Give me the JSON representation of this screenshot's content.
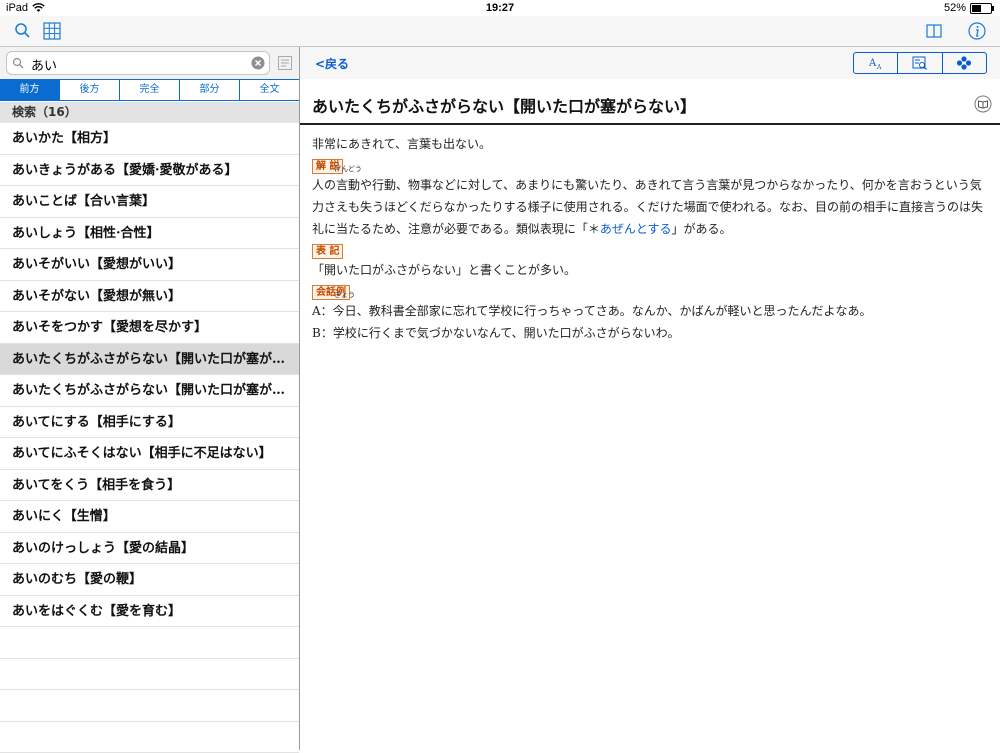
{
  "status": {
    "device": "iPad",
    "time": "19:27",
    "battery": "52%",
    "battery_level": 0.52
  },
  "search": {
    "value": "あい"
  },
  "segments": [
    "前方",
    "後方",
    "完全",
    "部分",
    "全文"
  ],
  "list_header": "検索（16）",
  "results": [
    "あいかた【相方】",
    "あいきょうがある【愛嬌·愛敬がある】",
    "あいことば【合い言葉】",
    "あいしょう【相性·合性】",
    "あいそがいい【愛想がいい】",
    "あいそがない【愛想が無い】",
    "あいそをつかす【愛想を尽かす】",
    "あいたくちがふさがらない【開いた口が塞が…",
    "あいたくちがふさがらない【開いた口が塞が…",
    "あいてにする【相手にする】",
    "あいてにふそくはない【相手に不足はない】",
    "あいてをくう【相手を食う】",
    "あいにく【生憎】",
    "あいのけっしょう【愛の結晶】",
    "あいのむち【愛の鞭】",
    "あいをはぐくむ【愛を育む】"
  ],
  "selected_index": 7,
  "nav": {
    "back": "<戻る"
  },
  "entry": {
    "title": "あいたくちがふさがらない【開いた口が塞がらない】",
    "definition": "非常にあきれて、言葉も出ない。",
    "explanation_label": "解 説",
    "explanation_ruby_base": "言動",
    "explanation_ruby_text": "げんどう",
    "explanation_pre": "人の",
    "explanation_post": "や行動、物事などに対して、あまりにも驚いたり、あきれて言う言葉が見つからなかったり、何かを言おうという気力さえも失うほどくだらなかったりする様子に使用される。くだけた場面で使われる。なお、目の前の相手に直接言うのは失礼に当たるため、注意が必要である。類似表現に「＊",
    "explanation_link": "あぜんとする",
    "explanation_end": "」がある。",
    "notation_label": "表 記",
    "notation": "「開いた口がふさがらない」と書くことが多い。",
    "conversation_label": "会話例",
    "conv_a_pre": "A：",
    "conv_a_ruby_base": "今日",
    "conv_a_ruby_text": "きょう",
    "conv_a_post": "、教科書全部家に忘れて学校に行っちゃってさあ。なんか、かばんが軽いと思ったんだよなあ。",
    "conv_b": "B：学校に行くまで気づかないなんて、開いた口がふさがらないわ。"
  },
  "colors": {
    "accent": "#0a6cd0",
    "label_orange": "#e07a2f",
    "selected_row": "#d9d9d9"
  }
}
